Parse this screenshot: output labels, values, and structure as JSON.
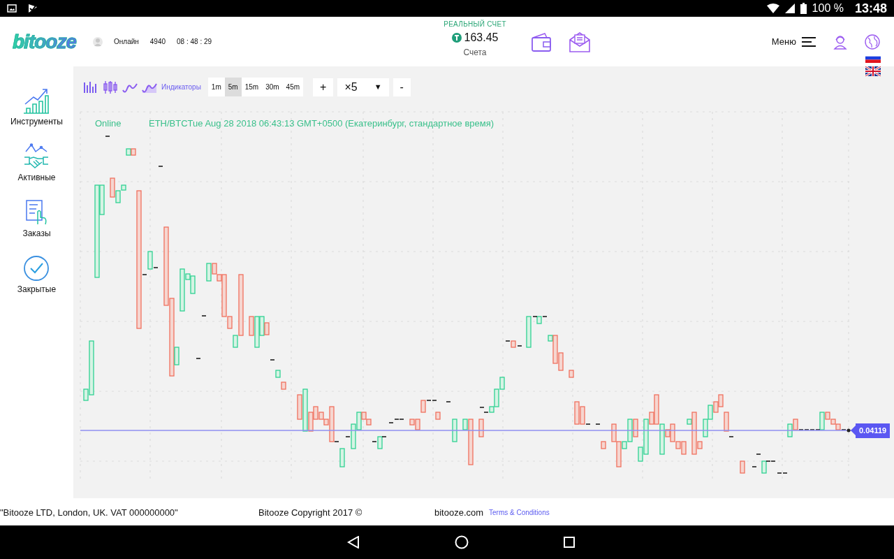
{
  "status_bar": {
    "battery": "100 %",
    "time": "13:48"
  },
  "header": {
    "logo": "bitooze",
    "online_label": "Онлайн",
    "online_count": "4940",
    "clock": "08 : 48 : 29",
    "account_type": "РЕАЛЬНЫЙ СЧЕТ",
    "balance": "163.45",
    "accounts_label": "Счета",
    "menu_label": "Меню"
  },
  "sidebar": {
    "items": [
      {
        "label": "Инструменты",
        "kind": "instruments"
      },
      {
        "label": "Активные",
        "kind": "active"
      },
      {
        "label": "Заказы",
        "kind": "orders"
      },
      {
        "label": "Закрытые",
        "kind": "closed"
      }
    ]
  },
  "toolbar": {
    "indicators": "Индикаторы",
    "timeframes": [
      {
        "label": "1m",
        "selected": false
      },
      {
        "label": "5m",
        "selected": true
      },
      {
        "label": "15m",
        "selected": false
      },
      {
        "label": "30m",
        "selected": false
      },
      {
        "label": "45m",
        "selected": false
      }
    ],
    "zoom_in": "+",
    "multiplier": "×5",
    "multiplier_caret": "▼",
    "zoom_out": "-"
  },
  "chart": {
    "status": "Online",
    "title": "ETH/BTCTue Aug 28 2018 06:43:13 GMT+0500 (Екатеринбург, стандартное время)",
    "price_label": "0.04119"
  },
  "footer": {
    "company": "\"Bitooze LTD, London, UK. VAT 000000000\"",
    "copyright": "Bitooze Copyright 2017 ©",
    "site": "bitooze.com",
    "terms_link": "Terms & Conditions"
  }
}
